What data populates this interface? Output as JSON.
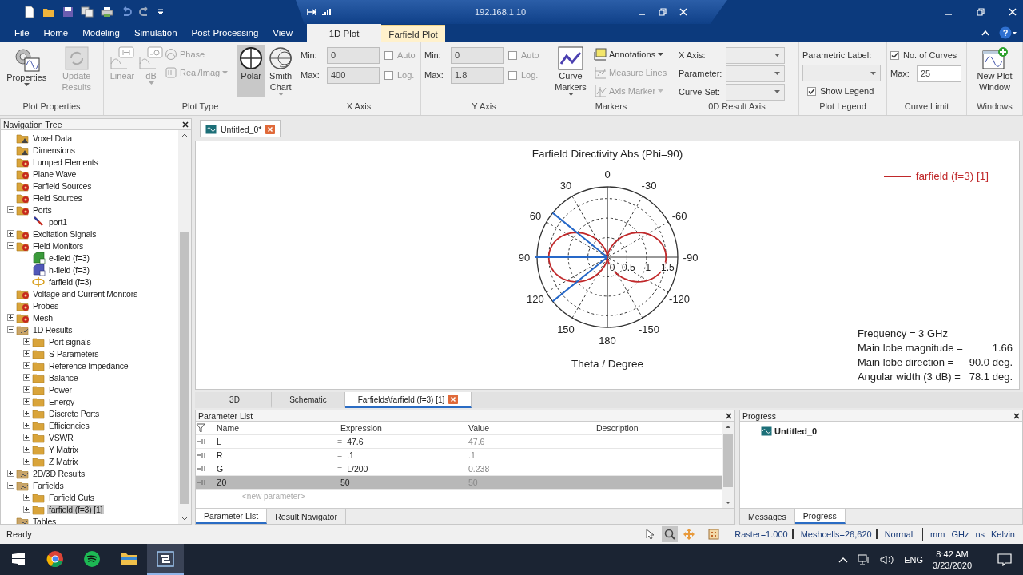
{
  "title_bar": {
    "address": "192.168.1.10",
    "help": "?"
  },
  "menu_tabs": [
    {
      "label": "File",
      "selected": false
    },
    {
      "label": "Home",
      "selected": false
    },
    {
      "label": "Modeling",
      "selected": false
    },
    {
      "label": "Simulation",
      "selected": false
    },
    {
      "label": "Post-Processing",
      "selected": false
    },
    {
      "label": "View",
      "selected": false
    }
  ],
  "context_tabs": [
    {
      "label": "1D Plot",
      "selected": true
    },
    {
      "label": "Farfield Plot",
      "selected": false
    }
  ],
  "ribbon": [
    {
      "kind": "large",
      "label": "Plot Properties",
      "buttons": [
        {
          "label": "Properties",
          "menu": true,
          "disabled": false
        },
        {
          "label": "Update Results",
          "disabled": true
        }
      ]
    },
    {
      "kind": "plot-type",
      "label": "Plot Type",
      "large": [
        {
          "label": "Linear",
          "disabled": true
        },
        {
          "label": "dB",
          "disabled": true,
          "menu": true
        }
      ],
      "small": [
        {
          "label": "Phase",
          "disabled": true
        },
        {
          "label": "Real/Imag",
          "disabled": true,
          "menu": true
        }
      ],
      "modes": [
        {
          "label": "Polar",
          "selected": true
        },
        {
          "label": "Smith Chart",
          "selected": false,
          "menu": true
        }
      ]
    },
    {
      "kind": "axis",
      "label": "X Axis",
      "fields": [
        {
          "label": "Min:",
          "value": "0",
          "disabled": true
        },
        {
          "label": "Max:",
          "value": "400",
          "disabled": true
        }
      ],
      "checks": [
        {
          "label": "Auto",
          "checked": false
        },
        {
          "label": "Log.",
          "checked": false
        }
      ]
    },
    {
      "kind": "axis",
      "label": "Y Axis",
      "fields": [
        {
          "label": "Min:",
          "value": "0",
          "disabled": true
        },
        {
          "label": "Max:",
          "value": "1.8",
          "disabled": true
        }
      ],
      "checks": [
        {
          "label": "Auto",
          "checked": false
        },
        {
          "label": "Log.",
          "checked": false
        }
      ]
    },
    {
      "kind": "markers",
      "label": "Markers",
      "large": {
        "label": "Curve Markers",
        "menu": true
      },
      "small": [
        {
          "label": "Annotations",
          "menu": true,
          "disabled": false
        },
        {
          "label": "Measure Lines",
          "disabled": true
        },
        {
          "label": "Axis Marker",
          "menu": true,
          "disabled": true
        }
      ]
    },
    {
      "kind": "dropdowns",
      "label": "0D Result Axis",
      "dropdowns": [
        {
          "label": "X Axis:"
        },
        {
          "label": "Parameter:"
        },
        {
          "label": "Curve Set:"
        }
      ]
    },
    {
      "kind": "legend",
      "label": "Plot Legend",
      "dropdown": {
        "label": "Parametric Label:"
      },
      "check": {
        "label": "Show Legend",
        "checked": true
      }
    },
    {
      "kind": "limit",
      "label": "Curve Limit",
      "check": {
        "label": "No. of Curves",
        "checked": true
      },
      "field": {
        "label": "Max:",
        "value": "25"
      }
    },
    {
      "kind": "large",
      "label": "Windows",
      "buttons": [
        {
          "label": "New Plot Window",
          "disabled": false
        }
      ]
    }
  ],
  "navigation_tree": {
    "title": "Navigation Tree",
    "items": [
      {
        "label": "Voxel Data",
        "kind": "info-folder",
        "selected": false
      },
      {
        "label": "Dimensions",
        "kind": "info-folder",
        "selected": false
      },
      {
        "label": "Lumped Elements",
        "kind": "gear-folder",
        "selected": false
      },
      {
        "label": "Plane Wave",
        "kind": "gear-folder",
        "selected": false
      },
      {
        "label": "Farfield Sources",
        "kind": "gear-folder",
        "selected": false
      },
      {
        "label": "Field Sources",
        "kind": "gear-folder",
        "selected": false
      },
      {
        "label": "Ports",
        "kind": "gear-folder",
        "selected": false,
        "expanded": true,
        "children": [
          {
            "label": "port1",
            "kind": "port",
            "selected": false
          }
        ]
      },
      {
        "label": "Excitation Signals",
        "kind": "gear-folder",
        "selected": false,
        "expanded": false
      },
      {
        "label": "Field Monitors",
        "kind": "gear-folder",
        "selected": false,
        "expanded": true,
        "children": [
          {
            "label": "e-field (f=3)",
            "kind": "e-field",
            "selected": false
          },
          {
            "label": "h-field (f=3)",
            "kind": "h-field",
            "selected": false
          },
          {
            "label": "farfield (f=3)",
            "kind": "farfield",
            "selected": false
          }
        ]
      },
      {
        "label": "Voltage and Current Monitors",
        "kind": "gear-folder",
        "selected": false
      },
      {
        "label": "Probes",
        "kind": "gear-folder",
        "selected": false
      },
      {
        "label": "Mesh",
        "kind": "gear-folder",
        "selected": false,
        "expanded": false
      },
      {
        "label": "1D Results",
        "kind": "results-folder",
        "selected": false,
        "expanded": true,
        "children": [
          {
            "label": "Port signals",
            "kind": "folder",
            "selected": false,
            "expanded": false
          },
          {
            "label": "S-Parameters",
            "kind": "folder",
            "selected": false,
            "expanded": false
          },
          {
            "label": "Reference Impedance",
            "kind": "folder",
            "selected": false,
            "expanded": false
          },
          {
            "label": "Balance",
            "kind": "folder",
            "selected": false,
            "expanded": false
          },
          {
            "label": "Power",
            "kind": "folder",
            "selected": false,
            "expanded": false
          },
          {
            "label": "Energy",
            "kind": "folder",
            "selected": false,
            "expanded": false
          },
          {
            "label": "Discrete Ports",
            "kind": "folder",
            "selected": false,
            "expanded": false
          },
          {
            "label": "Efficiencies",
            "kind": "folder",
            "selected": false,
            "expanded": false
          },
          {
            "label": "VSWR",
            "kind": "folder",
            "selected": false,
            "expanded": false
          },
          {
            "label": "Y Matrix",
            "kind": "folder",
            "selected": false,
            "expanded": false
          },
          {
            "label": "Z Matrix",
            "kind": "folder",
            "selected": false,
            "expanded": false
          }
        ]
      },
      {
        "label": "2D/3D Results",
        "kind": "results-folder",
        "selected": false,
        "expanded": false
      },
      {
        "label": "Farfields",
        "kind": "results-folder",
        "selected": false,
        "expanded": true,
        "children": [
          {
            "label": "Farfield Cuts",
            "kind": "folder",
            "selected": false,
            "expanded": false
          },
          {
            "label": "farfield (f=3) [1]",
            "kind": "folder",
            "selected": true,
            "expanded": false
          }
        ]
      },
      {
        "label": "Tables",
        "kind": "results-folder",
        "selected": false
      }
    ]
  },
  "document_tabs": [
    {
      "label": "Untitled_0*",
      "selected": true
    }
  ],
  "plot": {
    "title": "Farfield Directivity Abs (Phi=90)",
    "legend": "farfield (f=3) [1]",
    "xlabel": "Theta / Degree",
    "angle_labels": [
      "0",
      "-30",
      "-60",
      "-90",
      "-120",
      "-150",
      "180",
      "150",
      "120",
      "90",
      "60",
      "30"
    ],
    "radius_labels": [
      "0",
      "0.5",
      "1",
      "1.5"
    ],
    "info": [
      {
        "label": "Frequency = 3 GHz"
      },
      {
        "label": "Main lobe magnitude =",
        "value": "1.66"
      },
      {
        "label": "Main lobe direction =",
        "value": "90.0 deg."
      },
      {
        "label": "Angular width (3 dB) =",
        "value": "78.1 deg."
      }
    ]
  },
  "view_tabs": [
    {
      "label": "3D",
      "selected": false
    },
    {
      "label": "Schematic",
      "selected": false
    },
    {
      "label": "Farfields\\farfield (f=3) [1]",
      "selected": true
    }
  ],
  "parameter_list": {
    "title": "Parameter List",
    "columns": [
      "Name",
      "Expression",
      "Value",
      "Description"
    ],
    "rows": [
      {
        "name": "L",
        "prefix": "=",
        "expression": "47.6",
        "value": "47.6",
        "selected": false
      },
      {
        "name": "R",
        "prefix": "=",
        "expression": ".1",
        "value": ".1",
        "selected": false
      },
      {
        "name": "G",
        "prefix": "=",
        "expression": "L/200",
        "value": "0.238",
        "selected": false
      },
      {
        "name": "Z0",
        "expression": "50",
        "value": "50",
        "selected": true
      }
    ],
    "placeholder": "<new parameter>",
    "tabs": [
      {
        "label": "Parameter List",
        "selected": true
      },
      {
        "label": "Result Navigator",
        "selected": false
      }
    ]
  },
  "progress": {
    "title": "Progress",
    "items": [
      "Untitled_0"
    ],
    "tabs": [
      {
        "label": "Messages",
        "selected": false
      },
      {
        "label": "Progress",
        "selected": true
      }
    ]
  },
  "status_bar": {
    "text": "Ready",
    "tools": [
      {
        "selected": false
      },
      {
        "selected": true
      },
      {
        "selected": false
      }
    ],
    "fields": [
      "Raster=1.000",
      "Meshcells=26,620",
      "Normal"
    ],
    "units": [
      "mm",
      "GHz",
      "ns",
      "Kelvin"
    ]
  },
  "taskbar": {
    "apps": [
      {
        "selected": false
      },
      {
        "selected": false
      },
      {
        "selected": false
      },
      {
        "selected": true
      }
    ],
    "language": "ENG",
    "time": "8:42 AM",
    "date": "3/23/2020"
  }
}
